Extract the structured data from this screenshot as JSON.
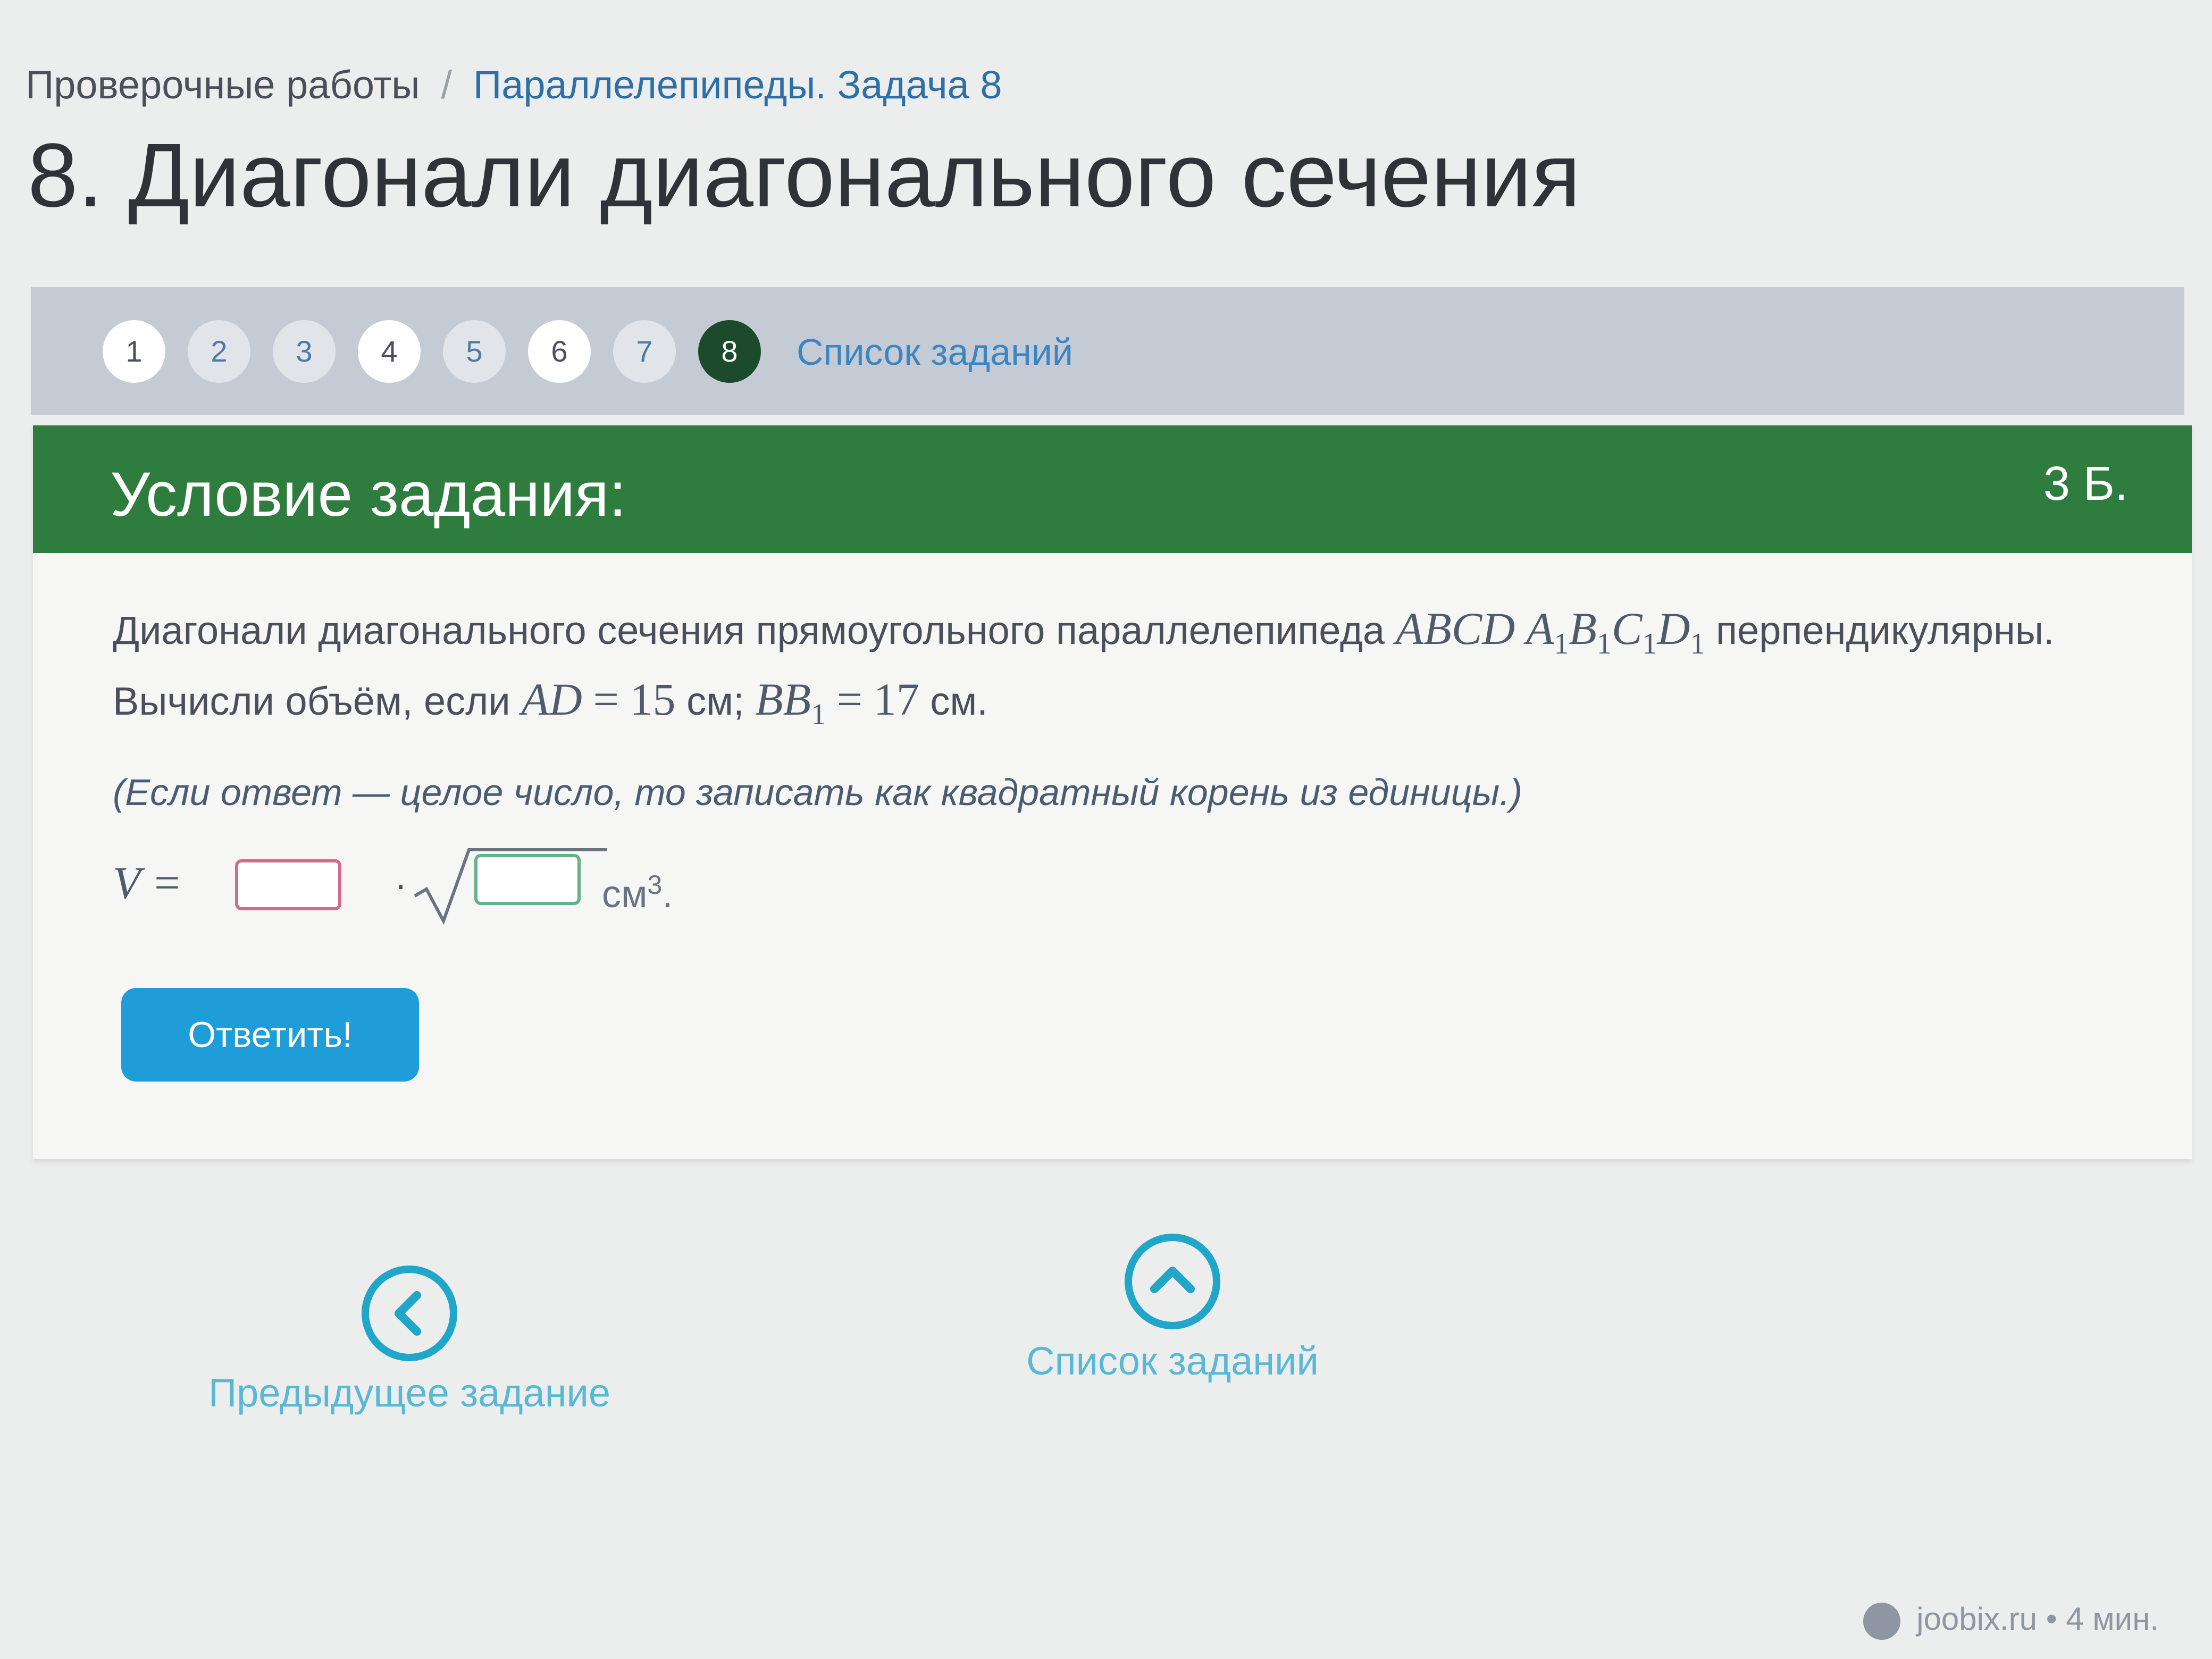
{
  "breadcrumb": {
    "root": "Проверочные работы",
    "separator": "/",
    "current": "Параллелепипеды. Задача 8"
  },
  "page_title": "8. Диагонали диагонального сечения",
  "steps": {
    "items": [
      {
        "label": "1",
        "state": "done"
      },
      {
        "label": "2",
        "state": "todo"
      },
      {
        "label": "3",
        "state": "todo"
      },
      {
        "label": "4",
        "state": "done"
      },
      {
        "label": "5",
        "state": "todo"
      },
      {
        "label": "6",
        "state": "done"
      },
      {
        "label": "7",
        "state": "todo"
      },
      {
        "label": "8",
        "state": "current"
      }
    ],
    "list_link": "Список заданий"
  },
  "task": {
    "header_title": "Условие задания:",
    "points": "3 Б.",
    "text_part1": "Диагонали диагонального сечения прямоугольного параллелепипеда",
    "prism": {
      "p1": "ABCD",
      "a": "A",
      "b": "B",
      "c": "C",
      "d": "D",
      "sub": "1"
    },
    "text_part2": "перпендикулярны.",
    "text_part3": "Вычисли объём, если",
    "ad_label": "AD",
    "eq": "=",
    "ad_value": "15",
    "unit": "см",
    "semicolon": ";",
    "bb_label": "BB",
    "bb_sub": "1",
    "bb_value": "17",
    "unit_end": "см.",
    "hint": "(Если ответ — целое число, то записать как квадратный корень из единицы.)",
    "formula": {
      "lhs": "V =",
      "dot": "·",
      "unit": "см",
      "unit_power": "3",
      "period": "."
    },
    "answer_button": "Ответить!"
  },
  "nav": {
    "prev_label": "Предыдущее задание",
    "list_label": "Список заданий"
  },
  "footer": {
    "site": "joobix.ru",
    "bullet": "•",
    "time": "4 мин."
  },
  "colors": {
    "header_green": "#2f7d3e",
    "current_step": "#1c4a2c",
    "answer_button": "#1e9dd8",
    "nav_icon": "#20a6c8"
  },
  "icons": {
    "prev": "chevron-left-icon",
    "list": "chevron-up-icon",
    "sqrt": "square-root-icon",
    "footer_logo": "site-logo-icon"
  }
}
